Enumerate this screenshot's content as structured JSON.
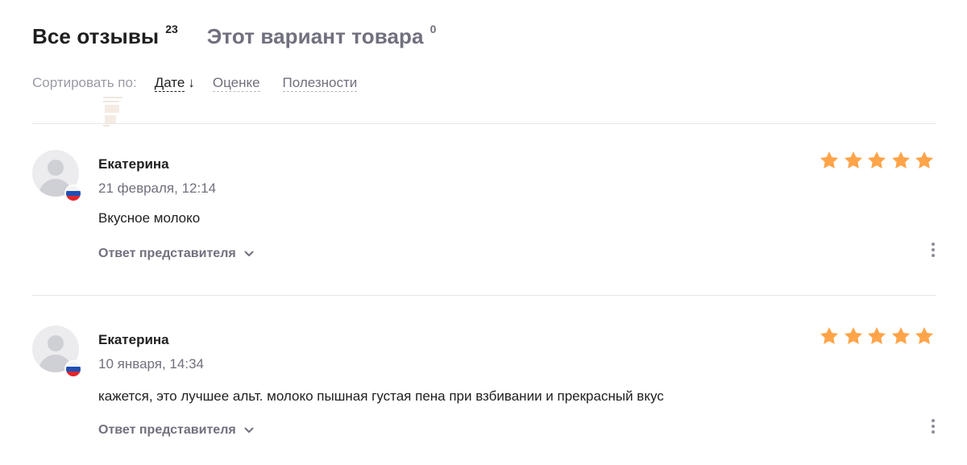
{
  "tabs": [
    {
      "label": "Все отзывы",
      "count": "23",
      "active": true
    },
    {
      "label": "Этот вариант товара",
      "count": "0",
      "active": false
    }
  ],
  "sort": {
    "prefix": "Сортировать по:",
    "options": [
      {
        "label": "Дате",
        "active": true,
        "arrow": "↓"
      },
      {
        "label": "Оценке",
        "active": false
      },
      {
        "label": "Полезности",
        "active": false
      }
    ]
  },
  "reviews": [
    {
      "author": "Екатерина",
      "date": "21 февраля, 12:14",
      "text": "Вкусное молоко",
      "rating": 5,
      "reply_label": "Ответ представителя",
      "flag": "russia-flag-icon"
    },
    {
      "author": "Екатерина",
      "date": "10 января, 14:34",
      "text": "кажется, это лучшее альт. молоко пышная густая пена при взбивании и прекрасный вкус",
      "rating": 5,
      "reply_label": "Ответ представителя",
      "flag": "russia-flag-icon"
    }
  ],
  "colors": {
    "star": "#ffa449",
    "text_primary": "#1f1f1f",
    "text_secondary": "#70707e",
    "divider": "#e6e6ea"
  }
}
